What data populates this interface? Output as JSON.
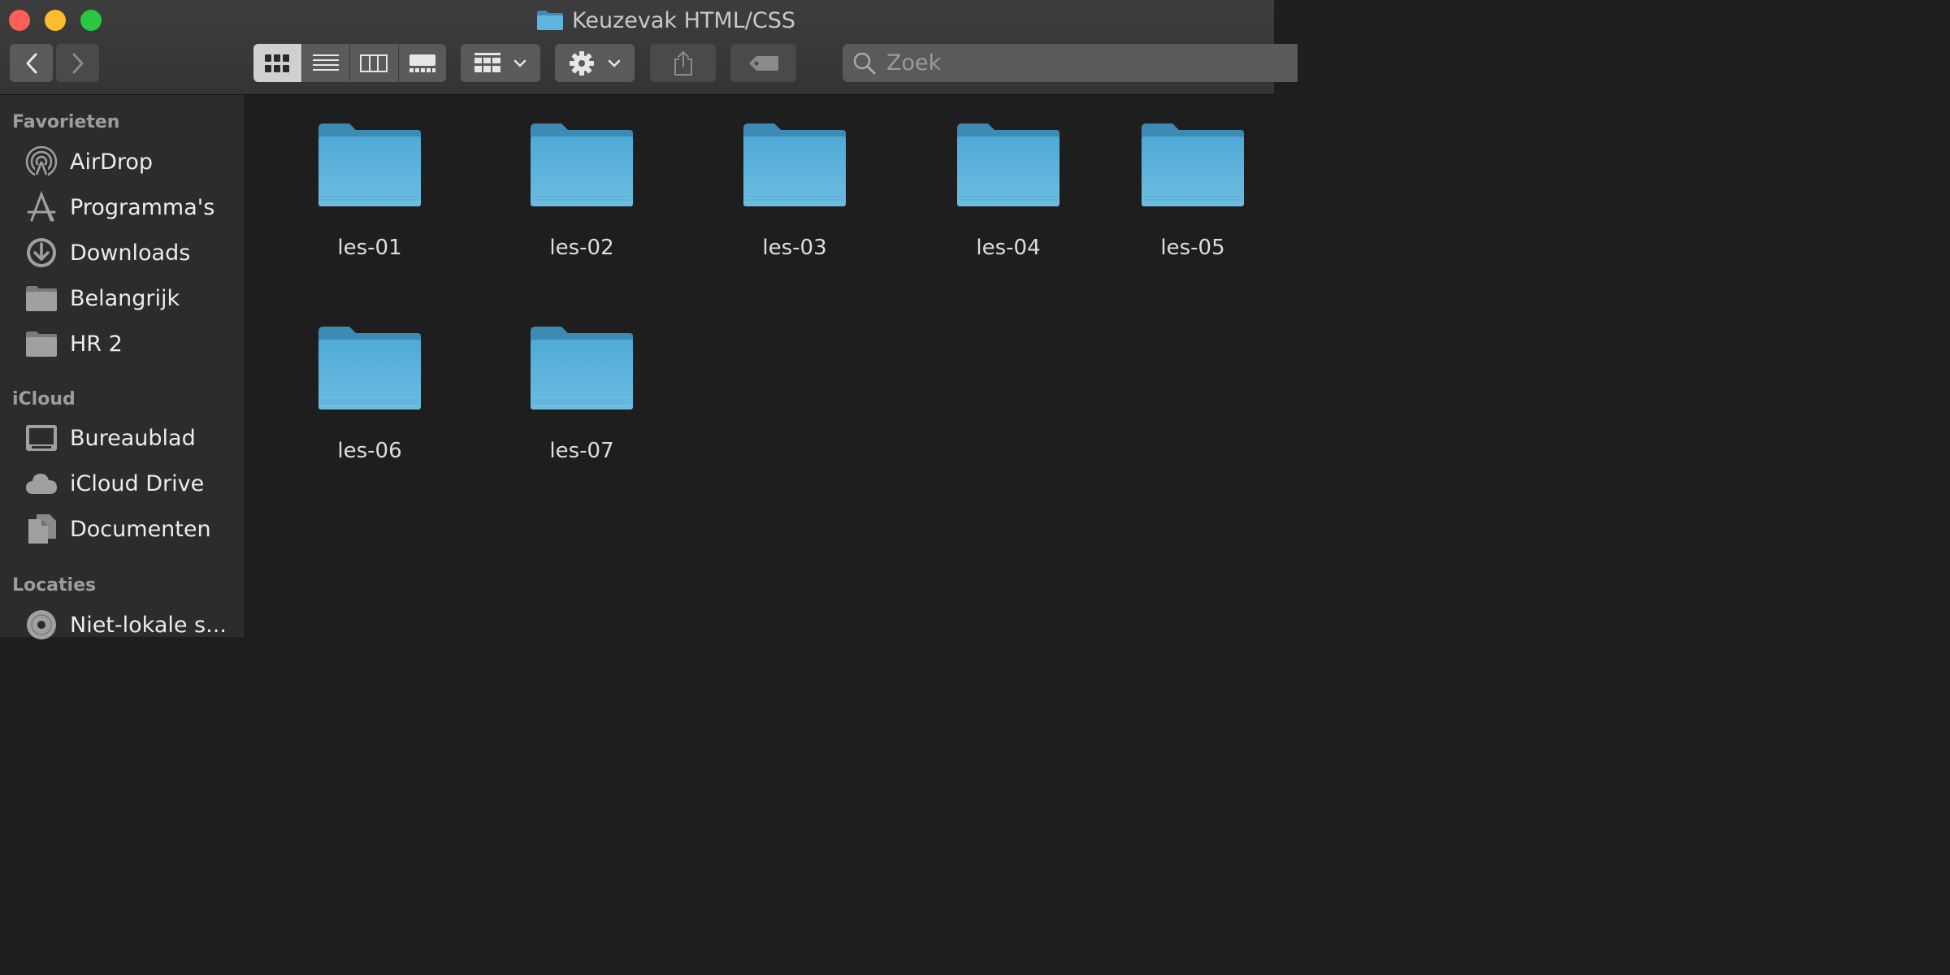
{
  "window": {
    "title": "Keuzevak HTML/CSS",
    "icons": [
      "close-button",
      "minimize-button",
      "maximize-button"
    ]
  },
  "toolbar": {
    "back_icon": "chevron-left-icon",
    "forward_icon": "chevron-right-icon",
    "view_modes": [
      "icon-view",
      "list-view",
      "column-view",
      "gallery-view"
    ],
    "active_view": "icon-view",
    "search": {
      "placeholder": "Zoek",
      "value": ""
    }
  },
  "sidebar": {
    "sections": [
      {
        "title": "Favorieten",
        "items": [
          {
            "label": "AirDrop",
            "icon": "airdrop-icon"
          },
          {
            "label": "Programma's",
            "icon": "applications-icon"
          },
          {
            "label": "Downloads",
            "icon": "downloads-icon"
          },
          {
            "label": "Belangrijk",
            "icon": "folder-icon"
          },
          {
            "label": "HR 2",
            "icon": "folder-icon"
          }
        ]
      },
      {
        "title": "iCloud",
        "items": [
          {
            "label": "Bureaublad",
            "icon": "desktop-icon"
          },
          {
            "label": "iCloud Drive",
            "icon": "cloud-icon"
          },
          {
            "label": "Documenten",
            "icon": "documents-icon"
          }
        ]
      },
      {
        "title": "Locaties",
        "items": [
          {
            "label": "Niet-lokale s...",
            "icon": "disc-icon"
          }
        ]
      }
    ]
  },
  "files": [
    {
      "name": "les-01"
    },
    {
      "name": "les-02"
    },
    {
      "name": "les-03"
    },
    {
      "name": "les-04"
    },
    {
      "name": "les-05"
    },
    {
      "name": "les-06"
    },
    {
      "name": "les-07"
    }
  ],
  "colors": {
    "folder_top": "#4faad8",
    "folder_bottom": "#6cbde0",
    "folder_tab": "#3d8bb5"
  }
}
